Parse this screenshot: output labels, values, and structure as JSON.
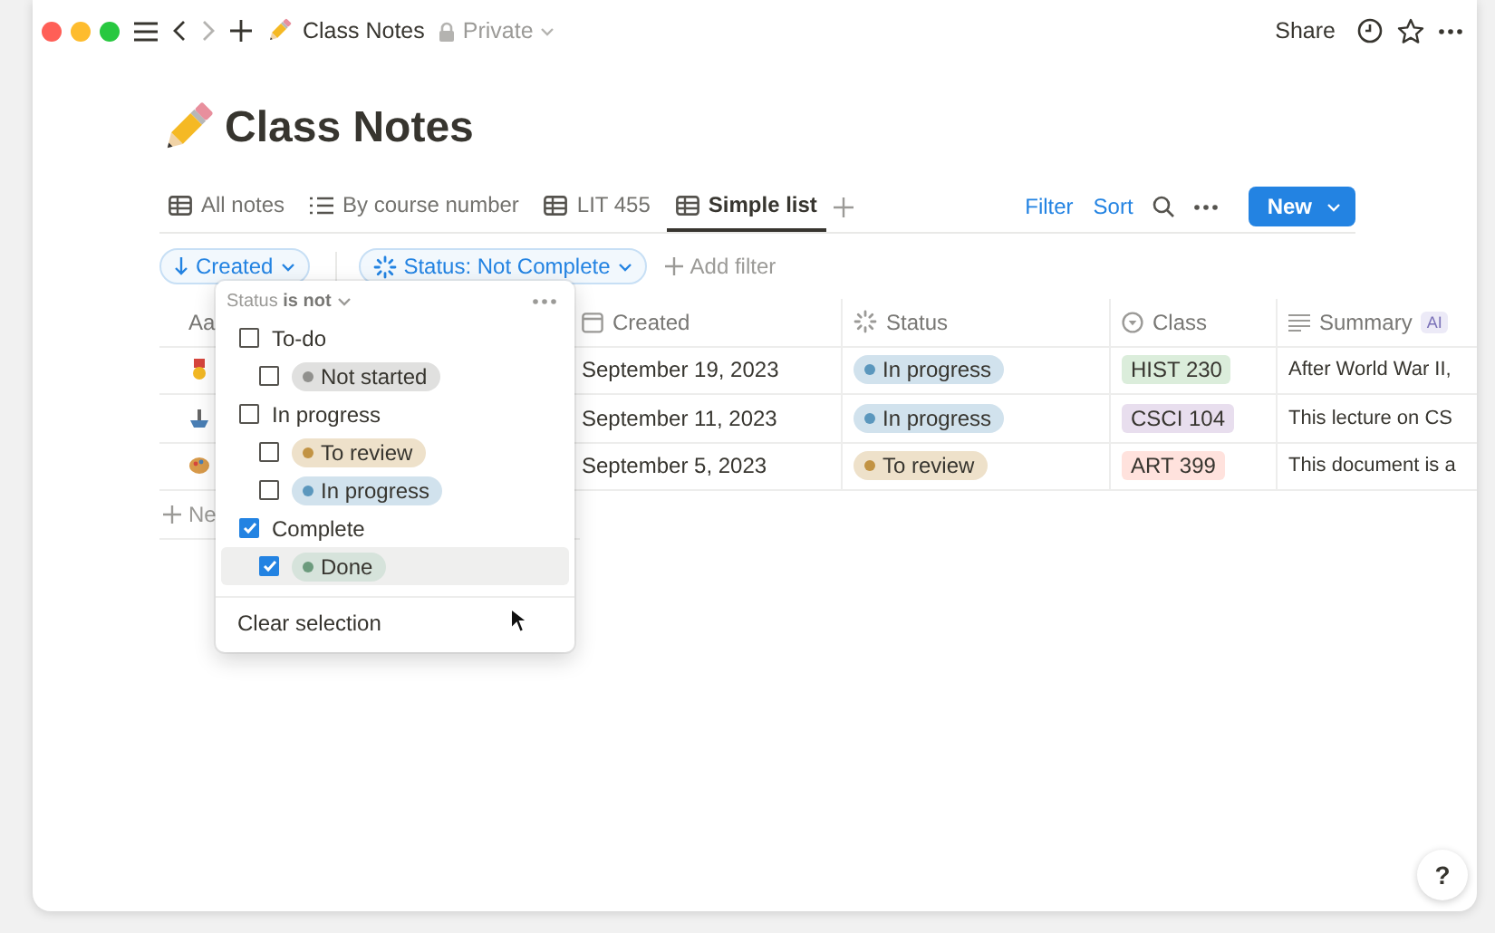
{
  "topbar": {
    "breadcrumb": "Class Notes",
    "privacy": "Private",
    "share": "Share"
  },
  "page": {
    "title": "Class Notes"
  },
  "views": [
    {
      "label": "All notes",
      "kind": "table",
      "selected": false
    },
    {
      "label": "By course number",
      "kind": "list",
      "selected": false
    },
    {
      "label": "LIT 455",
      "kind": "table",
      "selected": false
    },
    {
      "label": "Simple list",
      "kind": "table",
      "selected": true
    }
  ],
  "toolbar": {
    "filter": "Filter",
    "sort": "Sort",
    "new": "New"
  },
  "filters": [
    {
      "label": "Created",
      "kind": "sort"
    },
    {
      "label": "Status: Not Complete",
      "kind": "status"
    }
  ],
  "add_filter": "Add filter",
  "table": {
    "columns": [
      {
        "label": "Aa",
        "kind": "title"
      },
      {
        "label": "Created",
        "kind": "date"
      },
      {
        "label": "Status",
        "kind": "status"
      },
      {
        "label": "Class",
        "kind": "select"
      },
      {
        "label": "Summary",
        "kind": "text",
        "badge": "AI"
      }
    ],
    "rows": [
      {
        "created": "September 19, 2023",
        "status": {
          "label": "In progress",
          "color": "#5b97bd"
        },
        "class": {
          "label": "HIST 230",
          "color": "#dbeddb"
        },
        "summary": "After World War II,"
      },
      {
        "created": "September 11, 2023",
        "status": {
          "label": "In progress",
          "color": "#5b97bd"
        },
        "class": {
          "label": "CSCI 104",
          "color": "#e8deee"
        },
        "summary": "This lecture on CS"
      },
      {
        "created": "September 5, 2023",
        "status": {
          "label": "To review",
          "color": "#c29343"
        },
        "class": {
          "label": "ART 399",
          "color": "#ffe2dd"
        },
        "summary": "This document is a"
      }
    ],
    "new_row": "Ne"
  },
  "popup": {
    "property": "Status",
    "operator": "is not",
    "groups": [
      {
        "label": "To-do",
        "checked": false,
        "options": [
          {
            "label": "Not started",
            "color": "#91918e",
            "checked": false,
            "selected": false
          }
        ]
      },
      {
        "label": "In progress",
        "checked": false,
        "options": [
          {
            "label": "To review",
            "color": "#c29343",
            "checked": false,
            "selected": false
          },
          {
            "label": "In progress",
            "color": "#5b97bd",
            "checked": false,
            "selected": false
          }
        ]
      },
      {
        "label": "Complete",
        "checked": true,
        "options": [
          {
            "label": "Done",
            "color": "#6c9b7d",
            "checked": true,
            "selected": true
          }
        ]
      }
    ],
    "clear": "Clear selection"
  },
  "help": "?"
}
